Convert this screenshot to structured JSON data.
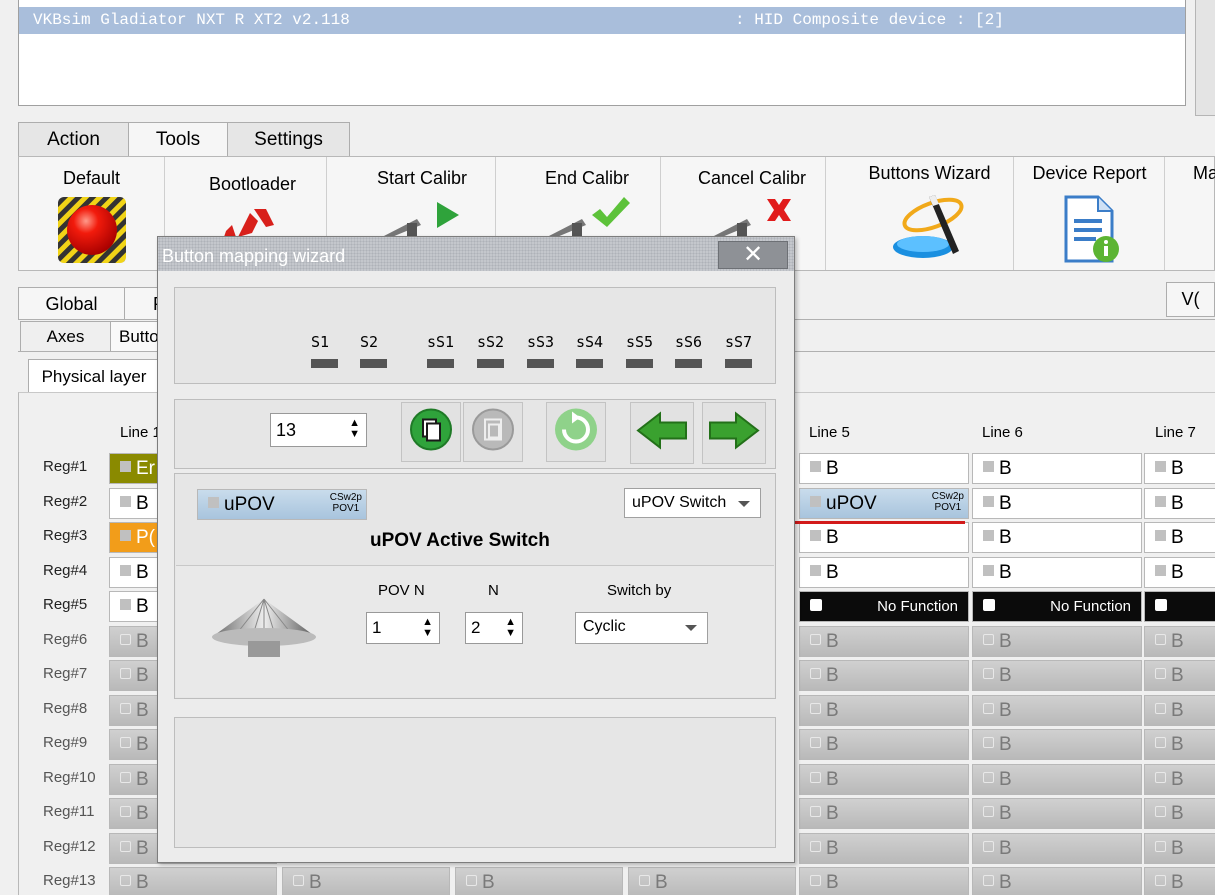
{
  "device_row": {
    "name": "VKBsim Gladiator NXT  R  XT2 v2.118",
    "desc": ": HID Composite device : [2]"
  },
  "main_tabs": [
    "Action",
    "Tools",
    "Settings"
  ],
  "ribbon": [
    {
      "label": "Default",
      "icon": "red-button-icon"
    },
    {
      "label": "Bootloader",
      "icon": "recycle-icon"
    },
    {
      "label": "Start Calibr",
      "icon": "caliper-play-icon"
    },
    {
      "label": "End Calibr",
      "icon": "caliper-check-icon"
    },
    {
      "label": "Cancel Calibr",
      "icon": "caliper-cross-icon"
    },
    {
      "label": "Buttons Wizard",
      "icon": "magic-wand-icon"
    },
    {
      "label": "Device Report",
      "icon": "report-info-icon"
    },
    {
      "label": "Ma",
      "icon": ""
    }
  ],
  "tabs2": {
    "global": "Global",
    "second": "P",
    "right": "V("
  },
  "tabs3": {
    "axes": "Axes",
    "buttons": "Butto"
  },
  "tabs4": {
    "physical": "Physical layer"
  },
  "grid": {
    "line1": "Line 1",
    "line5": "Line 5",
    "line6": "Line 6",
    "line7": "Line 7",
    "regs": [
      "Reg#1",
      "Reg#2",
      "Reg#3",
      "Reg#4",
      "Reg#5",
      "Reg#6",
      "Reg#7",
      "Reg#8",
      "Reg#9",
      "Reg#10",
      "Reg#11",
      "Reg#12",
      "Reg#13"
    ],
    "b": "B",
    "en": "Er",
    "po": "P(",
    "upov": "uPOV",
    "csw": "CSw2p",
    "pov1": "POV1",
    "nofn": "No Function"
  },
  "dialog": {
    "title": "Button mapping wizard",
    "close": "✕",
    "s_labels": [
      "S1",
      "S2",
      "sS1",
      "sS2",
      "sS3",
      "sS4",
      "sS5",
      "sS6",
      "sS7"
    ],
    "button_number": "13",
    "func_chip": {
      "label": "uPOV",
      "tag1": "CSw2p",
      "tag2": "POV1"
    },
    "func_type": "uPOV Switch",
    "section_title": "uPOV Active Switch",
    "pov_n_label": "POV N",
    "n_label": "N",
    "switch_by_label": "Switch by",
    "pov_n_value": "1",
    "n_value": "2",
    "switch_by_value": "Cyclic"
  },
  "colors": {
    "accent_green": "#2fa33b",
    "red_line": "#d21a1a",
    "upov_blue": "#a8c4dd"
  }
}
